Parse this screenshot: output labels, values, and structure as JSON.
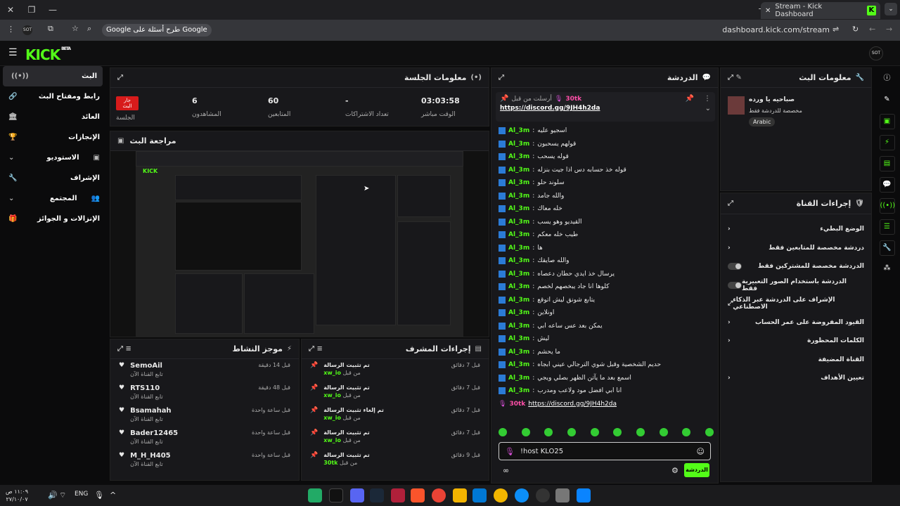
{
  "browser": {
    "tab_title": "Stream - Kick Dashboard",
    "url": "dashboard.kick.com/stream",
    "ask_google": "طرح أسئلة على Google"
  },
  "kick": {
    "logo": "KICK",
    "beta": "BETA"
  },
  "sidebar": {
    "items": [
      {
        "label": "البث"
      },
      {
        "label": "رابط ومفتاح البث"
      },
      {
        "label": "العائد"
      },
      {
        "label": "الإنجازات"
      },
      {
        "label": "الاستوديو"
      },
      {
        "label": "الإشراف"
      },
      {
        "label": "المجتمع"
      },
      {
        "label": "الإنزالات و الجوائز"
      }
    ]
  },
  "session": {
    "title": "معلومات الجلسة",
    "live_badge": "جار البث",
    "session_label": "الجلسة",
    "stats": [
      {
        "value": "03:03:58",
        "label": "الوقت مباشر"
      },
      {
        "value": "-",
        "label": "تعداد الاشتراكات"
      },
      {
        "value": "60",
        "label": "المتابعين"
      },
      {
        "value": "6",
        "label": "المشاهدون"
      }
    ]
  },
  "review": {
    "title": "مراجعة البث"
  },
  "chat": {
    "title": "الدردشة",
    "pinned_by": "أرسلت من قبل",
    "pinned_user": "30tk",
    "pinned_link": "https://discord.gg/9JH4h2da",
    "username": "Al_3m",
    "messages": [
      "اسجيو عليه",
      "قولهم يسحبون",
      "قوله يسحب",
      "قوله خذ حسابه دس اذا جيت بنزله",
      "سلوند حلو",
      "والله جامد",
      "خله معاك",
      "القيديو وهو يسب",
      "طيب خله معكم",
      "ها",
      "والله صايقك",
      "يرسال خذ ايدي حطان دعصاه",
      "كلوها انا جاد يبخصهم لخصم",
      "يتابع شونق ليش اتوقع",
      "اونلاين",
      "يمكن بعد عس ساعه ابي",
      "ليش",
      "ما يحشم",
      "حديم الشخصية وقبل شوي الترجالي عيني ابجاه",
      "اسمع بعد ما يآتن الظهر بصلي ويجي",
      "انا ابي افضل مود ولاعب ومدرب"
    ],
    "last_user": "30tk",
    "last_link": "https://discord.gg/9JH4h2da",
    "input_value": "!host KLO25",
    "send_label": "الدردشة"
  },
  "stream_info": {
    "title": "معلومات البث",
    "stream_title": "صباحيه يا ورده",
    "category": "مخصصة للدردشة فقط",
    "language": "Arabic"
  },
  "channel_actions": {
    "title": "إجراءات القناة",
    "items": [
      {
        "label": "الوضع البطيء",
        "type": "arrow"
      },
      {
        "label": "دردشة مخصصة للمتابعين فقط",
        "type": "arrow"
      },
      {
        "label": "الدردشة مخصصة للمشتركين فقط",
        "type": "toggle"
      },
      {
        "label": "الدردشة باستخدام الصور التعبيرية فقط",
        "type": "toggle"
      },
      {
        "label": "الإشراف على الدردشة عبر الذكاء الاصطناعي",
        "type": "link"
      },
      {
        "label": "القيود المفروضة على عمر الحساب",
        "type": "arrow"
      },
      {
        "label": "الكلمات المحظورة",
        "type": "arrow"
      },
      {
        "label": "القناة المضيفة",
        "type": "none"
      },
      {
        "label": "تعيين الأهداف",
        "type": "arrow"
      }
    ]
  },
  "activity": {
    "title": "موجز النشاط",
    "items": [
      {
        "name": "SemoAil",
        "sub": "تابع القناة الآن",
        "time": "قبل 14 دقيقة"
      },
      {
        "name": "RTS110",
        "sub": "تابع القناة الآن",
        "time": "قبل 48 دقيقة"
      },
      {
        "name": "Bsamahah",
        "sub": "تابع القناة الآن",
        "time": "قبل ساعة واحدة"
      },
      {
        "name": "Bader12465",
        "sub": "تابع القناة الآن",
        "time": "قبل ساعة واحدة"
      },
      {
        "name": "M_H_H405",
        "sub": "تابع القناة الآن",
        "time": "قبل ساعة واحدة"
      }
    ]
  },
  "mod_actions": {
    "title": "إجراءات المشرف",
    "by": "من قبل",
    "items": [
      {
        "action": "تم تثبيت الرسالة",
        "user": "xw_io",
        "time": "قبل 7 دقائق"
      },
      {
        "action": "تم تثبيت الرسالة",
        "user": "xw_io",
        "time": "قبل 7 دقائق"
      },
      {
        "action": "تم إلغاء تثبيت الرسالة",
        "user": "xw_io",
        "time": "قبل 7 دقائق"
      },
      {
        "action": "تم تثبيت الرسالة",
        "user": "xw_io",
        "time": "قبل 7 دقائق"
      },
      {
        "action": "تم تثبيت الرسالة",
        "user": "30tk",
        "time": "قبل 9 دقائق"
      }
    ]
  },
  "taskbar": {
    "time": "١١:٠٩ ص",
    "date": "٢٧/١٠/٠٧",
    "lang": "ENG"
  }
}
